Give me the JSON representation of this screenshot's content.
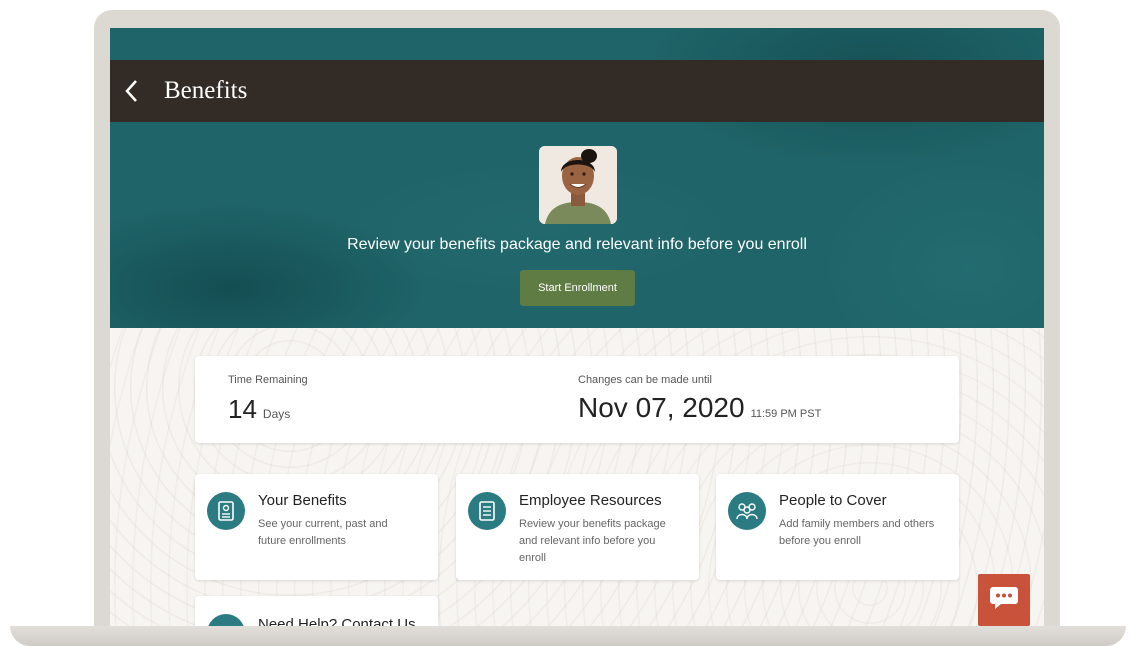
{
  "header": {
    "title": "Benefits"
  },
  "hero": {
    "message": "Review your benefits package and relevant info before you enroll",
    "start_button": "Start Enrollment"
  },
  "timing": {
    "time_remaining_label": "Time Remaining",
    "time_remaining_value": "14",
    "time_remaining_unit": "Days",
    "deadline_label": "Changes can be made until",
    "deadline_date": "Nov 07, 2020",
    "deadline_time": "11:59 PM PST"
  },
  "tiles": [
    {
      "title": "Your Benefits",
      "description": "See your current, past and future enrollments",
      "icon": "benefits-document-icon"
    },
    {
      "title": "Employee Resources",
      "description": "Review your benefits package and relevant info before you enroll",
      "icon": "resources-list-icon"
    },
    {
      "title": "People to Cover",
      "description": "Add family members and others before you enroll",
      "icon": "people-group-icon"
    }
  ],
  "help": {
    "title": "Need Help? Contact Us"
  },
  "colors": {
    "hero_teal": "#1f6468",
    "titlebar": "#332b25",
    "button_green": "#607c45",
    "icon_teal": "#2a7b82",
    "chat_red": "#c9523b"
  }
}
